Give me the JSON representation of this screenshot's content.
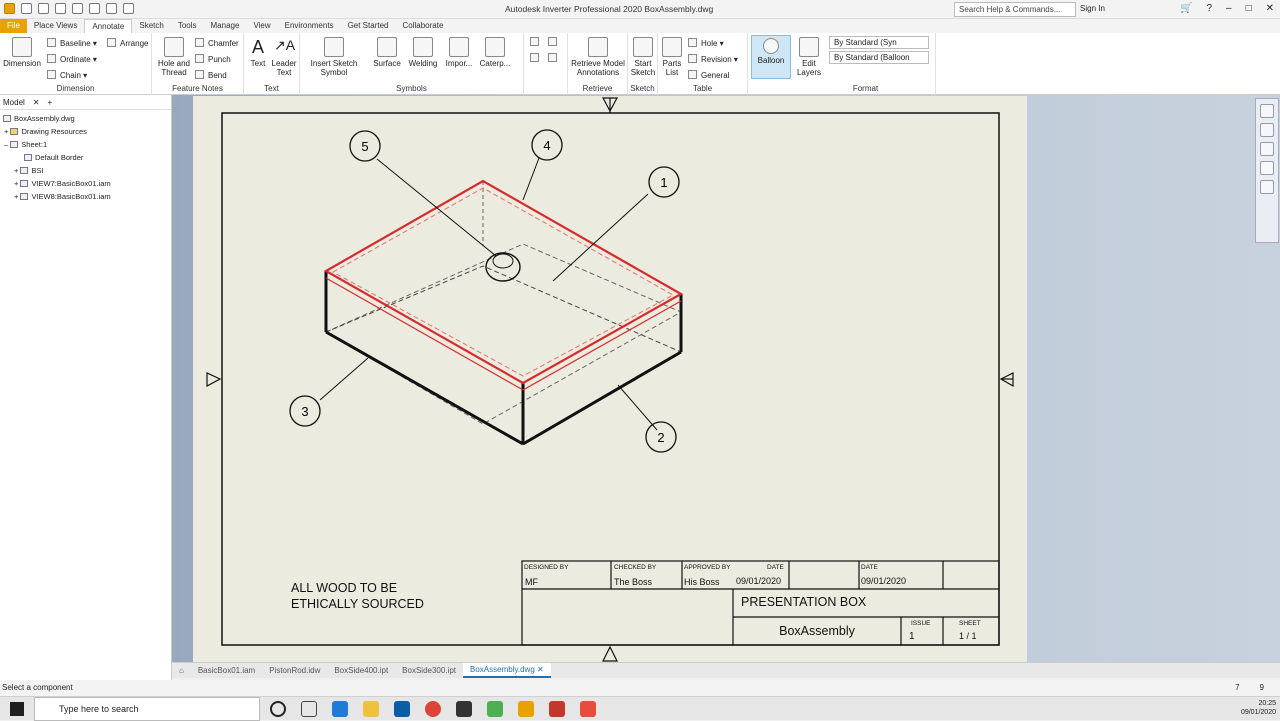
{
  "window": {
    "title": "Autodesk Inverter Professional 2020     BoxAssembly.dwg",
    "search_placeholder": "Search Help & Commands...",
    "signin": "Sign In"
  },
  "tabs": [
    "File",
    "Place Views",
    "Annotate",
    "Sketch",
    "Tools",
    "Manage",
    "View",
    "Environments",
    "Get Started",
    "Collaborate"
  ],
  "ribbon": {
    "dimension": {
      "label": "Dimension",
      "baseline": "Baseline",
      "ordinate": "Ordinate",
      "chain": "Chain",
      "arrange": "Arrange",
      "group": "Dimension"
    },
    "feature_notes": {
      "hole_thread": "Hole and Thread",
      "chamfer": "Chamfer",
      "punch": "Punch",
      "bend": "Bend",
      "group": "Feature Notes"
    },
    "text": {
      "text": "Text",
      "leader_text": "Leader Text",
      "group": "Text"
    },
    "symbols": {
      "insert_sketch_symbol": "Insert Sketch Symbol",
      "surface": "Surface",
      "welding": "Welding",
      "import": "Impor...",
      "caterpillar": "Caterp...",
      "group": "Symbols"
    },
    "retrieve": {
      "retrieve_model": "Retrieve Model Annotations",
      "group": "Retrieve"
    },
    "sketch": {
      "start_sketch": "Start Sketch",
      "group": "Sketch"
    },
    "table": {
      "parts_list": "Parts List",
      "hole": "Hole",
      "revision": "Revision",
      "general": "General",
      "group": "Table"
    },
    "balloon": "Balloon",
    "format": {
      "edit_layers": "Edit Layers",
      "style1": "By Standard (Syn",
      "style2": "By Standard (Balloon",
      "group": "Format"
    }
  },
  "browser": {
    "tab": "Model",
    "items": [
      "BoxAssembly.dwg",
      "Drawing Resources",
      "Sheet:1",
      "Default Border",
      "BSI",
      "VIEW7:BasicBox01.iam",
      "VIEW8:BasicBox01.iam"
    ]
  },
  "drawing": {
    "balloons": [
      "1",
      "2",
      "3",
      "4",
      "5"
    ],
    "note_line1": "ALL WOOD TO BE",
    "note_line2": "ETHICALLY SOURCED",
    "title_block": {
      "designed_by_label": "DESIGNED BY",
      "designed_by": "MF",
      "checked_by_label": "CHECKED BY",
      "checked_by": "The Boss",
      "approved_by_label": "APPROVED BY",
      "approved_by": "His Boss",
      "date_label": "DATE",
      "date1": "09/01/2020",
      "date_label2": "DATE",
      "date2": "09/01/2020",
      "title": "PRESENTATION BOX",
      "drawing_name": "BoxAssembly",
      "issue_label": "ISSUE",
      "issue": "1",
      "sheet_label": "SHEET",
      "sheet": "1 / 1"
    }
  },
  "doc_tabs": [
    "BasicBox01.iam",
    "PistonRod.idw",
    "BoxSide400.ipt",
    "BoxSide300.ipt",
    "BoxAssembly.dwg"
  ],
  "status": {
    "text": "Select a component",
    "n1": "7",
    "n2": "9"
  },
  "taskbar": {
    "search": "Type here to search",
    "time": "20:25",
    "date": "09/01/2020"
  }
}
